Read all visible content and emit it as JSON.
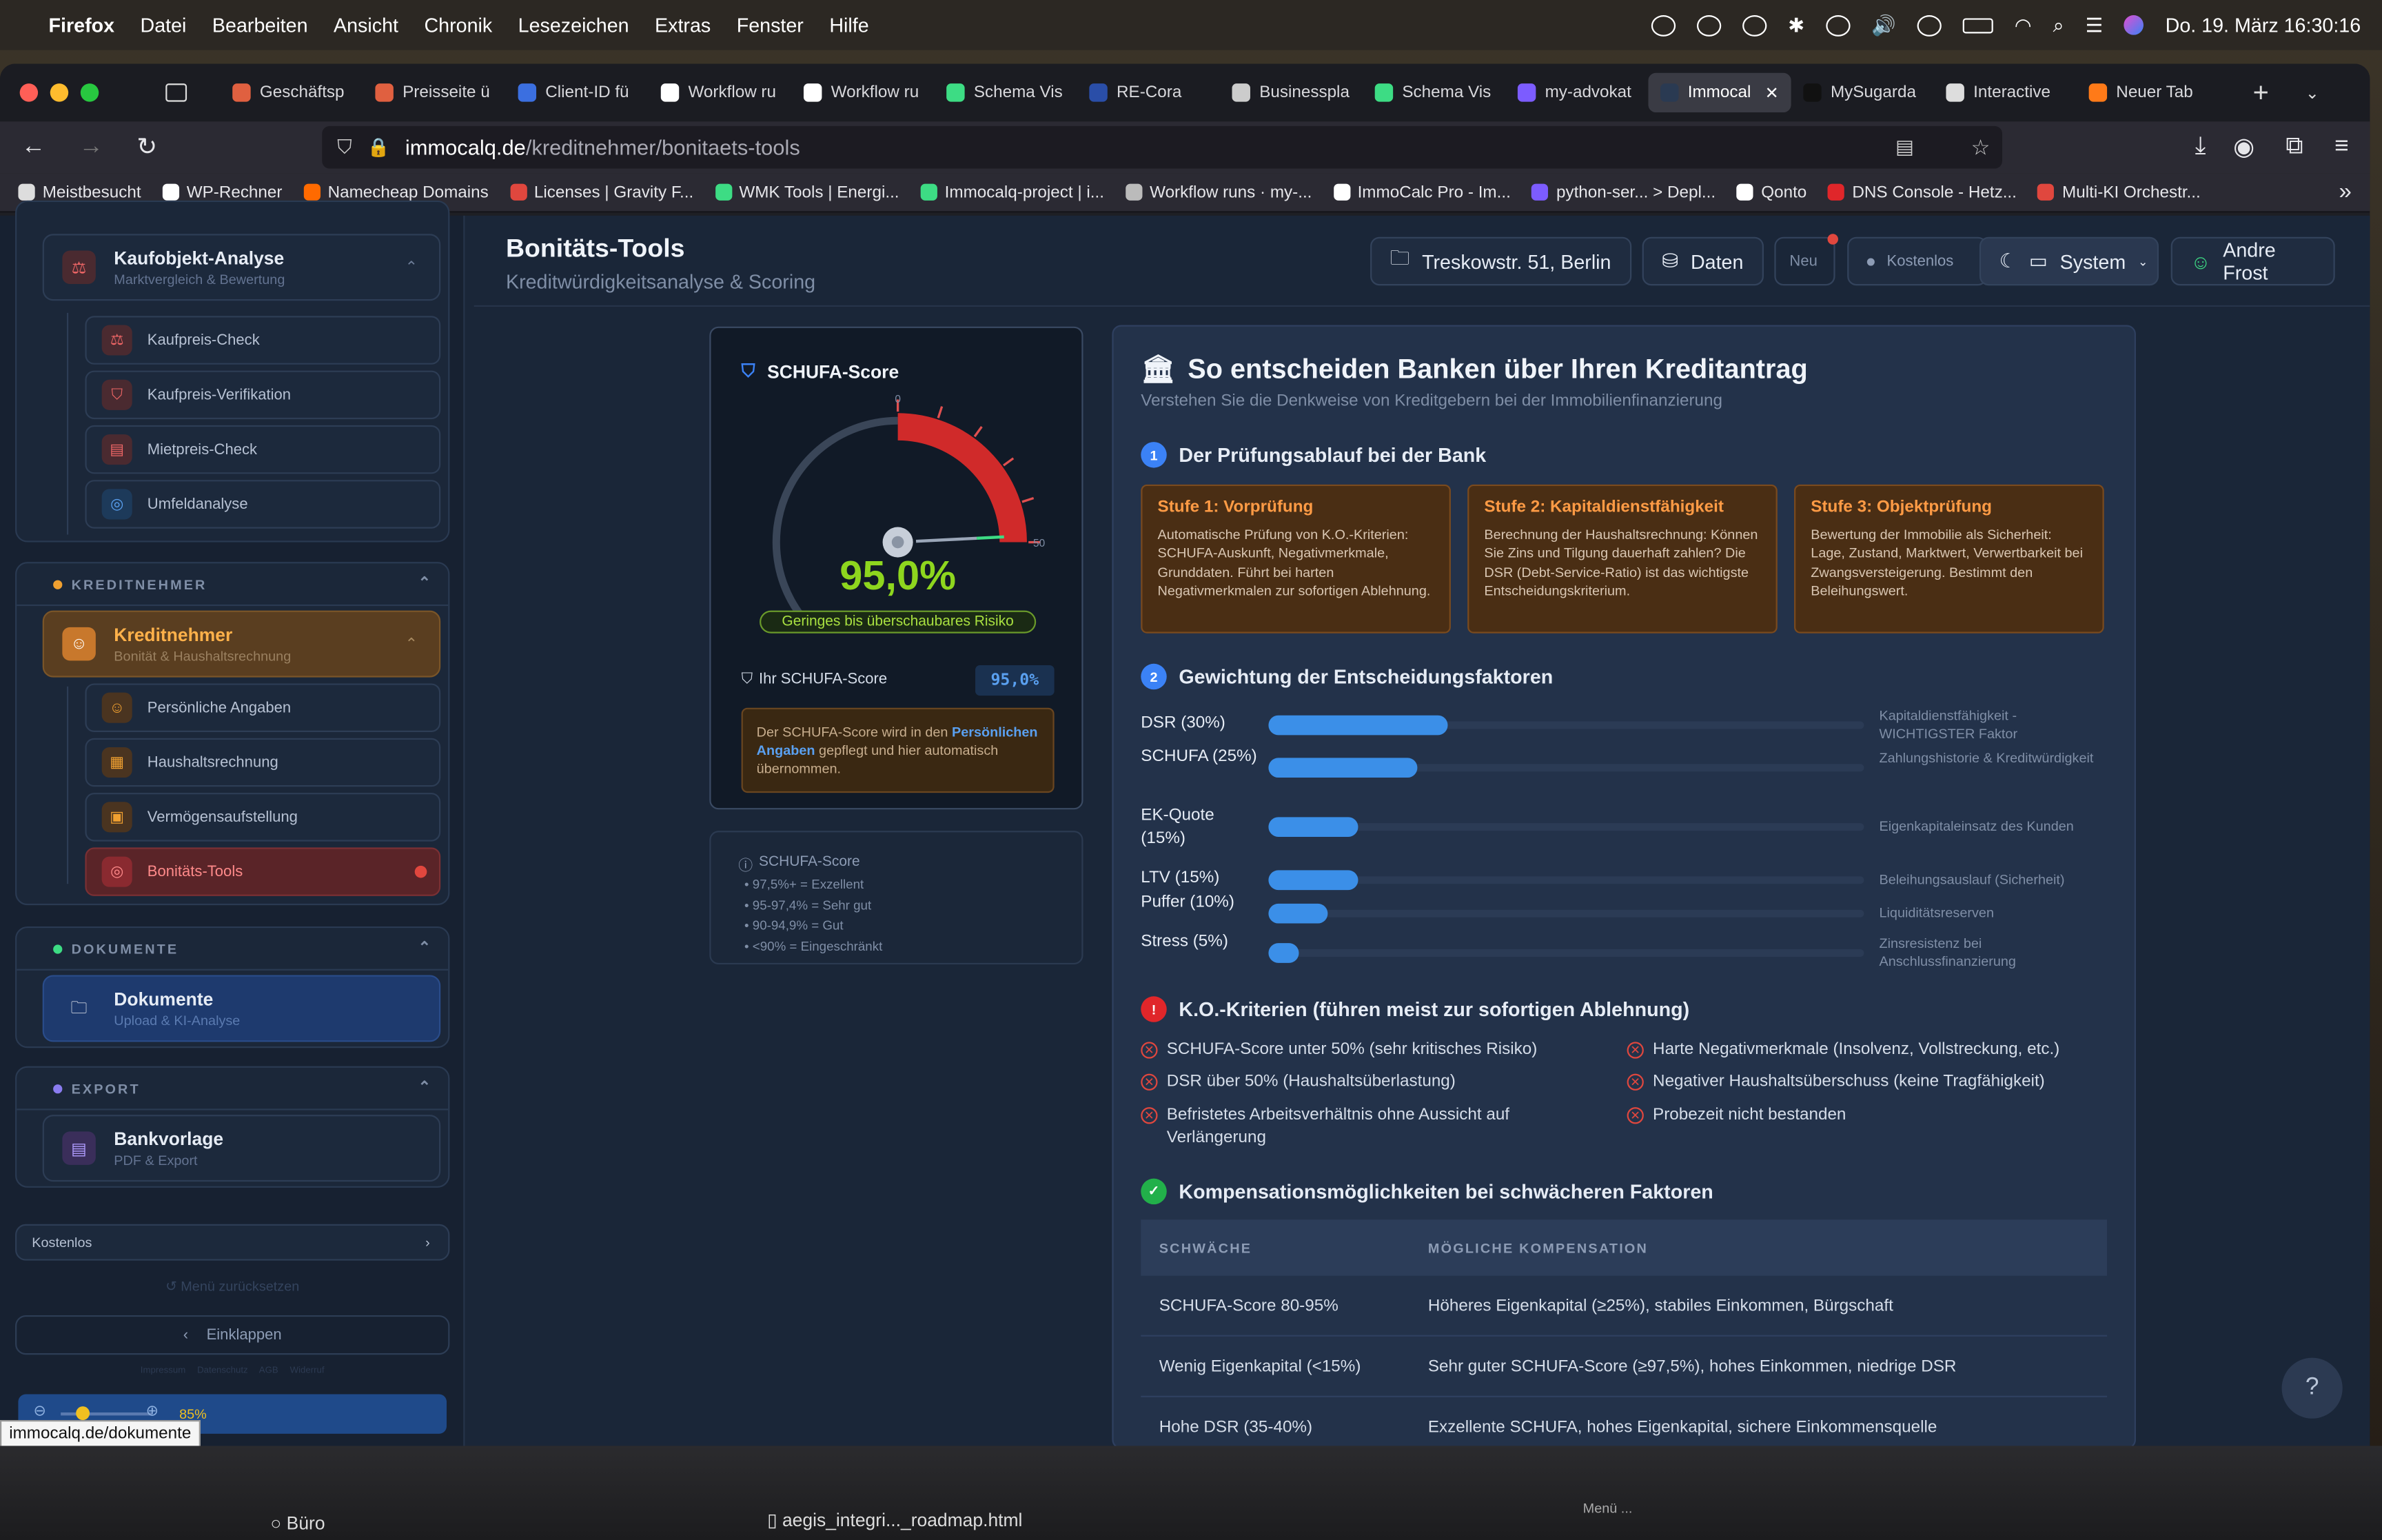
{
  "menubar": {
    "app": "Firefox",
    "items": [
      "Datei",
      "Bearbeiten",
      "Ansicht",
      "Chronik",
      "Lesezeichen",
      "Extras",
      "Fenster",
      "Hilfe"
    ],
    "datetime": "Do. 19. März 16:30:16"
  },
  "tabs": [
    {
      "label": "Geschäftsp",
      "color": "#e06040"
    },
    {
      "label": "Preisseite ü",
      "color": "#e06040"
    },
    {
      "label": "Client-ID fü",
      "color": "#3b6fe0"
    },
    {
      "label": "Workflow ru",
      "color": "#ffffff"
    },
    {
      "label": "Workflow ru",
      "color": "#ffffff"
    },
    {
      "label": "Schema Vis",
      "color": "#3ddc84"
    },
    {
      "label": "RE-Cora",
      "color": "#2a4ea8"
    },
    {
      "label": "Businesspla",
      "color": "#cccccc"
    },
    {
      "label": "Schema Vis",
      "color": "#3ddc84"
    },
    {
      "label": "my-advokat",
      "color": "#7c5cff"
    },
    {
      "label": "Immocal",
      "color": "#2a3a52",
      "active": true
    },
    {
      "label": "MySugarda",
      "color": "#111111"
    },
    {
      "label": "Interactive",
      "color": "#dddddd"
    },
    {
      "label": "Neuer Tab",
      "color": "#ff7a18"
    }
  ],
  "url": {
    "host": "immocalq.de",
    "path": "/kreditnehmer/bonitaets-tools"
  },
  "bookmarks": [
    "Meistbesucht",
    "WP-Rechner",
    "Namecheap Domains",
    "Licenses | Gravity F...",
    "WMK Tools | Energi...",
    "Immocalq-project | i...",
    "Workflow runs · my-...",
    "ImmoCalc Pro - Im...",
    "python-ser... > Depl...",
    "Qonto",
    "DNS Console - Hetz...",
    "Multi-KI Orchestr..."
  ],
  "sidebar": {
    "top_card": {
      "title": "Kaufobjekt-Analyse",
      "sub": "Marktvergleich & Bewertung"
    },
    "top_items": [
      "Kaufpreis-Check",
      "Kaufpreis-Verifikation",
      "Mietpreis-Check",
      "Umfeldanalyse"
    ],
    "kreditnehmer": {
      "header": "KREDITNEHMER",
      "title": "Kreditnehmer",
      "sub": "Bonität & Haushaltsrechnung",
      "items": [
        "Persönliche Angaben",
        "Haushaltsrechnung",
        "Vermögensaufstellung",
        "Bonitäts-Tools"
      ]
    },
    "dokumente": {
      "header": "DOKUMENTE",
      "title": "Dokumente",
      "sub": "Upload & KI-Analyse"
    },
    "export": {
      "header": "EXPORT",
      "title": "Bankvorlage",
      "sub": "PDF & Export"
    },
    "plan": "Kostenlos",
    "reset": "Menü zurücksetzen",
    "collapse": "Einklappen",
    "footer": "Impressum   Datenschutz   AGB   Widerruf",
    "zoom": "85%"
  },
  "header": {
    "title": "Bonitäts-Tools",
    "subtitle": "Kreditwürdigkeitsanalyse & Scoring",
    "address": "Treskowstr. 51, Berlin",
    "data_btn": "Daten",
    "neu": "Neu",
    "kostenlos": "Kostenlos",
    "system": "System",
    "user": "Andre Frost"
  },
  "score": {
    "title": "SCHUFA-Score",
    "value": "95,0%",
    "value_num": 95.0,
    "badge": "Geringes bis überschaubares Risiko",
    "label": "Ihr SCHUFA-Score",
    "field": "95,0%",
    "tick0": "0",
    "tick50": "50",
    "note_a": "Der SCHUFA-Score wird in den ",
    "note_link": "Persönlichen Angaben",
    "note_b": " gepflegt und hier automatisch übernommen."
  },
  "scale": {
    "title": "SCHUFA-Score",
    "items": [
      "97,5%+ = Exzellent",
      "95-97,4% = Sehr gut",
      "90-94,9% = Gut",
      "<90% = Eingeschränkt"
    ]
  },
  "info": {
    "title": "So entscheiden Banken über Ihren Kreditantrag",
    "subtitle": "Verstehen Sie die Denkweise von Kreditgebern bei der Immobilienfinanzierung",
    "sec1": "Der Prüfungsablauf bei der Bank",
    "stages": [
      {
        "title": "Stufe 1: Vorprüfung",
        "desc": "Automatische Prüfung von K.O.-Kriterien: SCHUFA-Auskunft, Negativmerkmale, Grunddaten. Führt bei harten Negativmerkmalen zur sofortigen Ablehnung."
      },
      {
        "title": "Stufe 2: Kapitaldienstfähigkeit",
        "desc": "Berechnung der Haushaltsrechnung: Können Sie Zins und Tilgung dauerhaft zahlen? Die DSR (Debt-Service-Ratio) ist das wichtigste Entscheidungskriterium."
      },
      {
        "title": "Stufe 3: Objektprüfung",
        "desc": "Bewertung der Immobilie als Sicherheit: Lage, Zustand, Marktwert, Verwertbarkeit bei Zwangsversteigerung. Bestimmt den Beleihungswert."
      }
    ],
    "sec2": "Gewichtung der Entscheidungsfaktoren",
    "factors": [
      {
        "label": "DSR (30%)",
        "weight": 30,
        "desc": "Kapitaldienstfähigkeit - WICHTIGSTER Faktor"
      },
      {
        "label": "SCHUFA (25%)",
        "weight": 25,
        "desc": "Zahlungshistorie & Kreditwürdigkeit"
      },
      {
        "label": "EK-Quote (15%)",
        "weight": 15,
        "desc": "Eigenkapitaleinsatz des Kunden"
      },
      {
        "label": "LTV (15%)",
        "weight": 15,
        "desc": "Beleihungsauslauf (Sicherheit)"
      },
      {
        "label": "Puffer (10%)",
        "weight": 10,
        "desc": "Liquiditätsreserven"
      },
      {
        "label": "Stress (5%)",
        "weight": 5,
        "desc": "Zinsresistenz bei Anschlussfinanzierung"
      }
    ],
    "sec3": "K.O.-Kriterien (führen meist zur sofortigen Ablehnung)",
    "ko_left": [
      "SCHUFA-Score unter 50% (sehr kritisches Risiko)",
      "DSR über 50% (Haushaltsüberlastung)",
      "Befristetes Arbeitsverhältnis ohne Aussicht auf Verlängerung"
    ],
    "ko_right": [
      "Harte Negativmerkmale (Insolvenz, Vollstreckung, etc.)",
      "Negativer Haushaltsüberschuss (keine Tragfähigkeit)",
      "Probezeit nicht bestanden"
    ],
    "sec4": "Kompensationsmöglichkeiten bei schwächeren Faktoren",
    "table": {
      "headers": [
        "SCHWÄCHE",
        "MÖGLICHE KOMPENSATION"
      ],
      "rows": [
        [
          "SCHUFA-Score 80-95%",
          "Höheres Eigenkapital (≥25%), stabiles Einkommen, Bürgschaft"
        ],
        [
          "Wenig Eigenkapital (<15%)",
          "Sehr guter SCHUFA-Score (≥97,5%), hohes Einkommen, niedrige DSR"
        ],
        [
          "Hohe DSR (35-40%)",
          "Exzellente SCHUFA, hohes Eigenkapital, sichere Einkommensquelle"
        ]
      ]
    }
  },
  "status_url": "immocalq.de/dokumente",
  "dock": {
    "left": "Büro",
    "file": "aegis_integri..._roadmap.html",
    "mid": "Menü ..."
  },
  "help": "?"
}
